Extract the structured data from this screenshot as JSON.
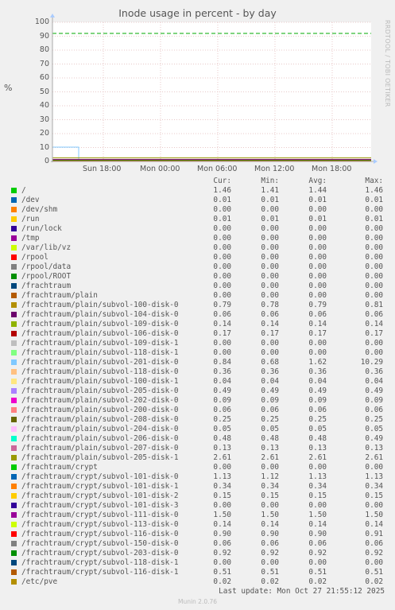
{
  "chart_data": {
    "type": "line",
    "title": "Inode usage in percent - by day",
    "ylabel": "%",
    "ylim": [
      0,
      100
    ],
    "y_ticks": [
      "0",
      "10",
      "20",
      "30",
      "40",
      "50",
      "60",
      "70",
      "80",
      "90",
      "100"
    ],
    "x_ticks": [
      "Sun 18:00",
      "Mon 00:00",
      "Mon 06:00",
      "Mon 12:00",
      "Mon 18:00"
    ],
    "warning_level": 92,
    "grid": true,
    "columns": [
      "Cur:",
      "Min:",
      "Avg:",
      "Max:"
    ],
    "series": [
      {
        "name": "/",
        "color": "#00cc00",
        "cur": "1.46",
        "min": "1.41",
        "avg": "1.44",
        "max": "1.46"
      },
      {
        "name": "/dev",
        "color": "#0066b3",
        "cur": "0.01",
        "min": "0.01",
        "avg": "0.01",
        "max": "0.01"
      },
      {
        "name": "/dev/shm",
        "color": "#ff8000",
        "cur": "0.00",
        "min": "0.00",
        "avg": "0.00",
        "max": "0.00"
      },
      {
        "name": "/run",
        "color": "#ffcc00",
        "cur": "0.01",
        "min": "0.01",
        "avg": "0.01",
        "max": "0.01"
      },
      {
        "name": "/run/lock",
        "color": "#330099",
        "cur": "0.00",
        "min": "0.00",
        "avg": "0.00",
        "max": "0.00"
      },
      {
        "name": "/tmp",
        "color": "#990099",
        "cur": "0.00",
        "min": "0.00",
        "avg": "0.00",
        "max": "0.00"
      },
      {
        "name": "/var/lib/vz",
        "color": "#ccff00",
        "cur": "0.00",
        "min": "0.00",
        "avg": "0.00",
        "max": "0.00"
      },
      {
        "name": "/rpool",
        "color": "#ff0000",
        "cur": "0.00",
        "min": "0.00",
        "avg": "0.00",
        "max": "0.00"
      },
      {
        "name": "/rpool/data",
        "color": "#808080",
        "cur": "0.00",
        "min": "0.00",
        "avg": "0.00",
        "max": "0.00"
      },
      {
        "name": "/rpool/ROOT",
        "color": "#008f00",
        "cur": "0.00",
        "min": "0.00",
        "avg": "0.00",
        "max": "0.00"
      },
      {
        "name": "/frachtraum",
        "color": "#00487d",
        "cur": "0.00",
        "min": "0.00",
        "avg": "0.00",
        "max": "0.00"
      },
      {
        "name": "/frachtraum/plain",
        "color": "#b35a00",
        "cur": "0.00",
        "min": "0.00",
        "avg": "0.00",
        "max": "0.00"
      },
      {
        "name": "/frachtraum/plain/subvol-100-disk-0",
        "color": "#b38f00",
        "cur": "0.79",
        "min": "0.78",
        "avg": "0.79",
        "max": "0.81"
      },
      {
        "name": "/frachtraum/plain/subvol-104-disk-0",
        "color": "#6b006b",
        "cur": "0.06",
        "min": "0.06",
        "avg": "0.06",
        "max": "0.06"
      },
      {
        "name": "/frachtraum/plain/subvol-109-disk-0",
        "color": "#8fb300",
        "cur": "0.14",
        "min": "0.14",
        "avg": "0.14",
        "max": "0.14"
      },
      {
        "name": "/frachtraum/plain/subvol-106-disk-0",
        "color": "#b30000",
        "cur": "0.17",
        "min": "0.17",
        "avg": "0.17",
        "max": "0.17"
      },
      {
        "name": "/frachtraum/plain/subvol-109-disk-1",
        "color": "#bebebe",
        "cur": "0.00",
        "min": "0.00",
        "avg": "0.00",
        "max": "0.00"
      },
      {
        "name": "/frachtraum/plain/subvol-118-disk-1",
        "color": "#80ff80",
        "cur": "0.00",
        "min": "0.00",
        "avg": "0.00",
        "max": "0.00"
      },
      {
        "name": "/frachtraum/plain/subvol-201-disk-0",
        "color": "#80c9ff",
        "cur": "0.84",
        "min": "0.68",
        "avg": "1.62",
        "max": "10.29"
      },
      {
        "name": "/frachtraum/plain/subvol-118-disk-0",
        "color": "#ffc080",
        "cur": "0.36",
        "min": "0.36",
        "avg": "0.36",
        "max": "0.36"
      },
      {
        "name": "/frachtraum/plain/subvol-100-disk-1",
        "color": "#ffe680",
        "cur": "0.04",
        "min": "0.04",
        "avg": "0.04",
        "max": "0.04"
      },
      {
        "name": "/frachtraum/plain/subvol-205-disk-0",
        "color": "#aa80ff",
        "cur": "0.49",
        "min": "0.49",
        "avg": "0.49",
        "max": "0.49"
      },
      {
        "name": "/frachtraum/plain/subvol-202-disk-0",
        "color": "#ee00cc",
        "cur": "0.09",
        "min": "0.09",
        "avg": "0.09",
        "max": "0.09"
      },
      {
        "name": "/frachtraum/plain/subvol-200-disk-0",
        "color": "#ff8080",
        "cur": "0.06",
        "min": "0.06",
        "avg": "0.06",
        "max": "0.06"
      },
      {
        "name": "/frachtraum/plain/subvol-208-disk-0",
        "color": "#666600",
        "cur": "0.25",
        "min": "0.25",
        "avg": "0.25",
        "max": "0.25"
      },
      {
        "name": "/frachtraum/plain/subvol-204-disk-0",
        "color": "#ffbfff",
        "cur": "0.05",
        "min": "0.05",
        "avg": "0.05",
        "max": "0.05"
      },
      {
        "name": "/frachtraum/plain/subvol-206-disk-0",
        "color": "#00ffcc",
        "cur": "0.48",
        "min": "0.48",
        "avg": "0.48",
        "max": "0.49"
      },
      {
        "name": "/frachtraum/plain/subvol-207-disk-0",
        "color": "#cc6699",
        "cur": "0.13",
        "min": "0.13",
        "avg": "0.13",
        "max": "0.13"
      },
      {
        "name": "/frachtraum/plain/subvol-205-disk-1",
        "color": "#999900",
        "cur": "2.61",
        "min": "2.61",
        "avg": "2.61",
        "max": "2.61"
      },
      {
        "name": "/frachtraum/crypt",
        "color": "#00cc00",
        "cur": "0.00",
        "min": "0.00",
        "avg": "0.00",
        "max": "0.00"
      },
      {
        "name": "/frachtraum/crypt/subvol-101-disk-0",
        "color": "#0066b3",
        "cur": "1.13",
        "min": "1.12",
        "avg": "1.13",
        "max": "1.13"
      },
      {
        "name": "/frachtraum/crypt/subvol-101-disk-1",
        "color": "#ff8000",
        "cur": "0.34",
        "min": "0.34",
        "avg": "0.34",
        "max": "0.34"
      },
      {
        "name": "/frachtraum/crypt/subvol-101-disk-2",
        "color": "#ffcc00",
        "cur": "0.15",
        "min": "0.15",
        "avg": "0.15",
        "max": "0.15"
      },
      {
        "name": "/frachtraum/crypt/subvol-101-disk-3",
        "color": "#330099",
        "cur": "0.00",
        "min": "0.00",
        "avg": "0.00",
        "max": "0.00"
      },
      {
        "name": "/frachtraum/crypt/subvol-111-disk-0",
        "color": "#990099",
        "cur": "1.50",
        "min": "1.50",
        "avg": "1.50",
        "max": "1.50"
      },
      {
        "name": "/frachtraum/crypt/subvol-113-disk-0",
        "color": "#ccff00",
        "cur": "0.14",
        "min": "0.14",
        "avg": "0.14",
        "max": "0.14"
      },
      {
        "name": "/frachtraum/crypt/subvol-116-disk-0",
        "color": "#ff0000",
        "cur": "0.90",
        "min": "0.90",
        "avg": "0.90",
        "max": "0.91"
      },
      {
        "name": "/frachtraum/crypt/subvol-150-disk-0",
        "color": "#808080",
        "cur": "0.06",
        "min": "0.06",
        "avg": "0.06",
        "max": "0.06"
      },
      {
        "name": "/frachtraum/crypt/subvol-203-disk-0",
        "color": "#008f00",
        "cur": "0.92",
        "min": "0.92",
        "avg": "0.92",
        "max": "0.92"
      },
      {
        "name": "/frachtraum/crypt/subvol-118-disk-1",
        "color": "#00487d",
        "cur": "0.00",
        "min": "0.00",
        "avg": "0.00",
        "max": "0.00"
      },
      {
        "name": "/frachtraum/crypt/subvol-116-disk-1",
        "color": "#b35a00",
        "cur": "0.51",
        "min": "0.51",
        "avg": "0.51",
        "max": "0.51"
      },
      {
        "name": "/etc/pve",
        "color": "#b38f00",
        "cur": "0.02",
        "min": "0.02",
        "avg": "0.02",
        "max": "0.02"
      }
    ]
  },
  "side_label": "RRDTOOL / TOBI OETIKER",
  "last_update": "Last update: Mon Oct 27 21:55:12 2025",
  "footer": "Munin 2.0.76"
}
